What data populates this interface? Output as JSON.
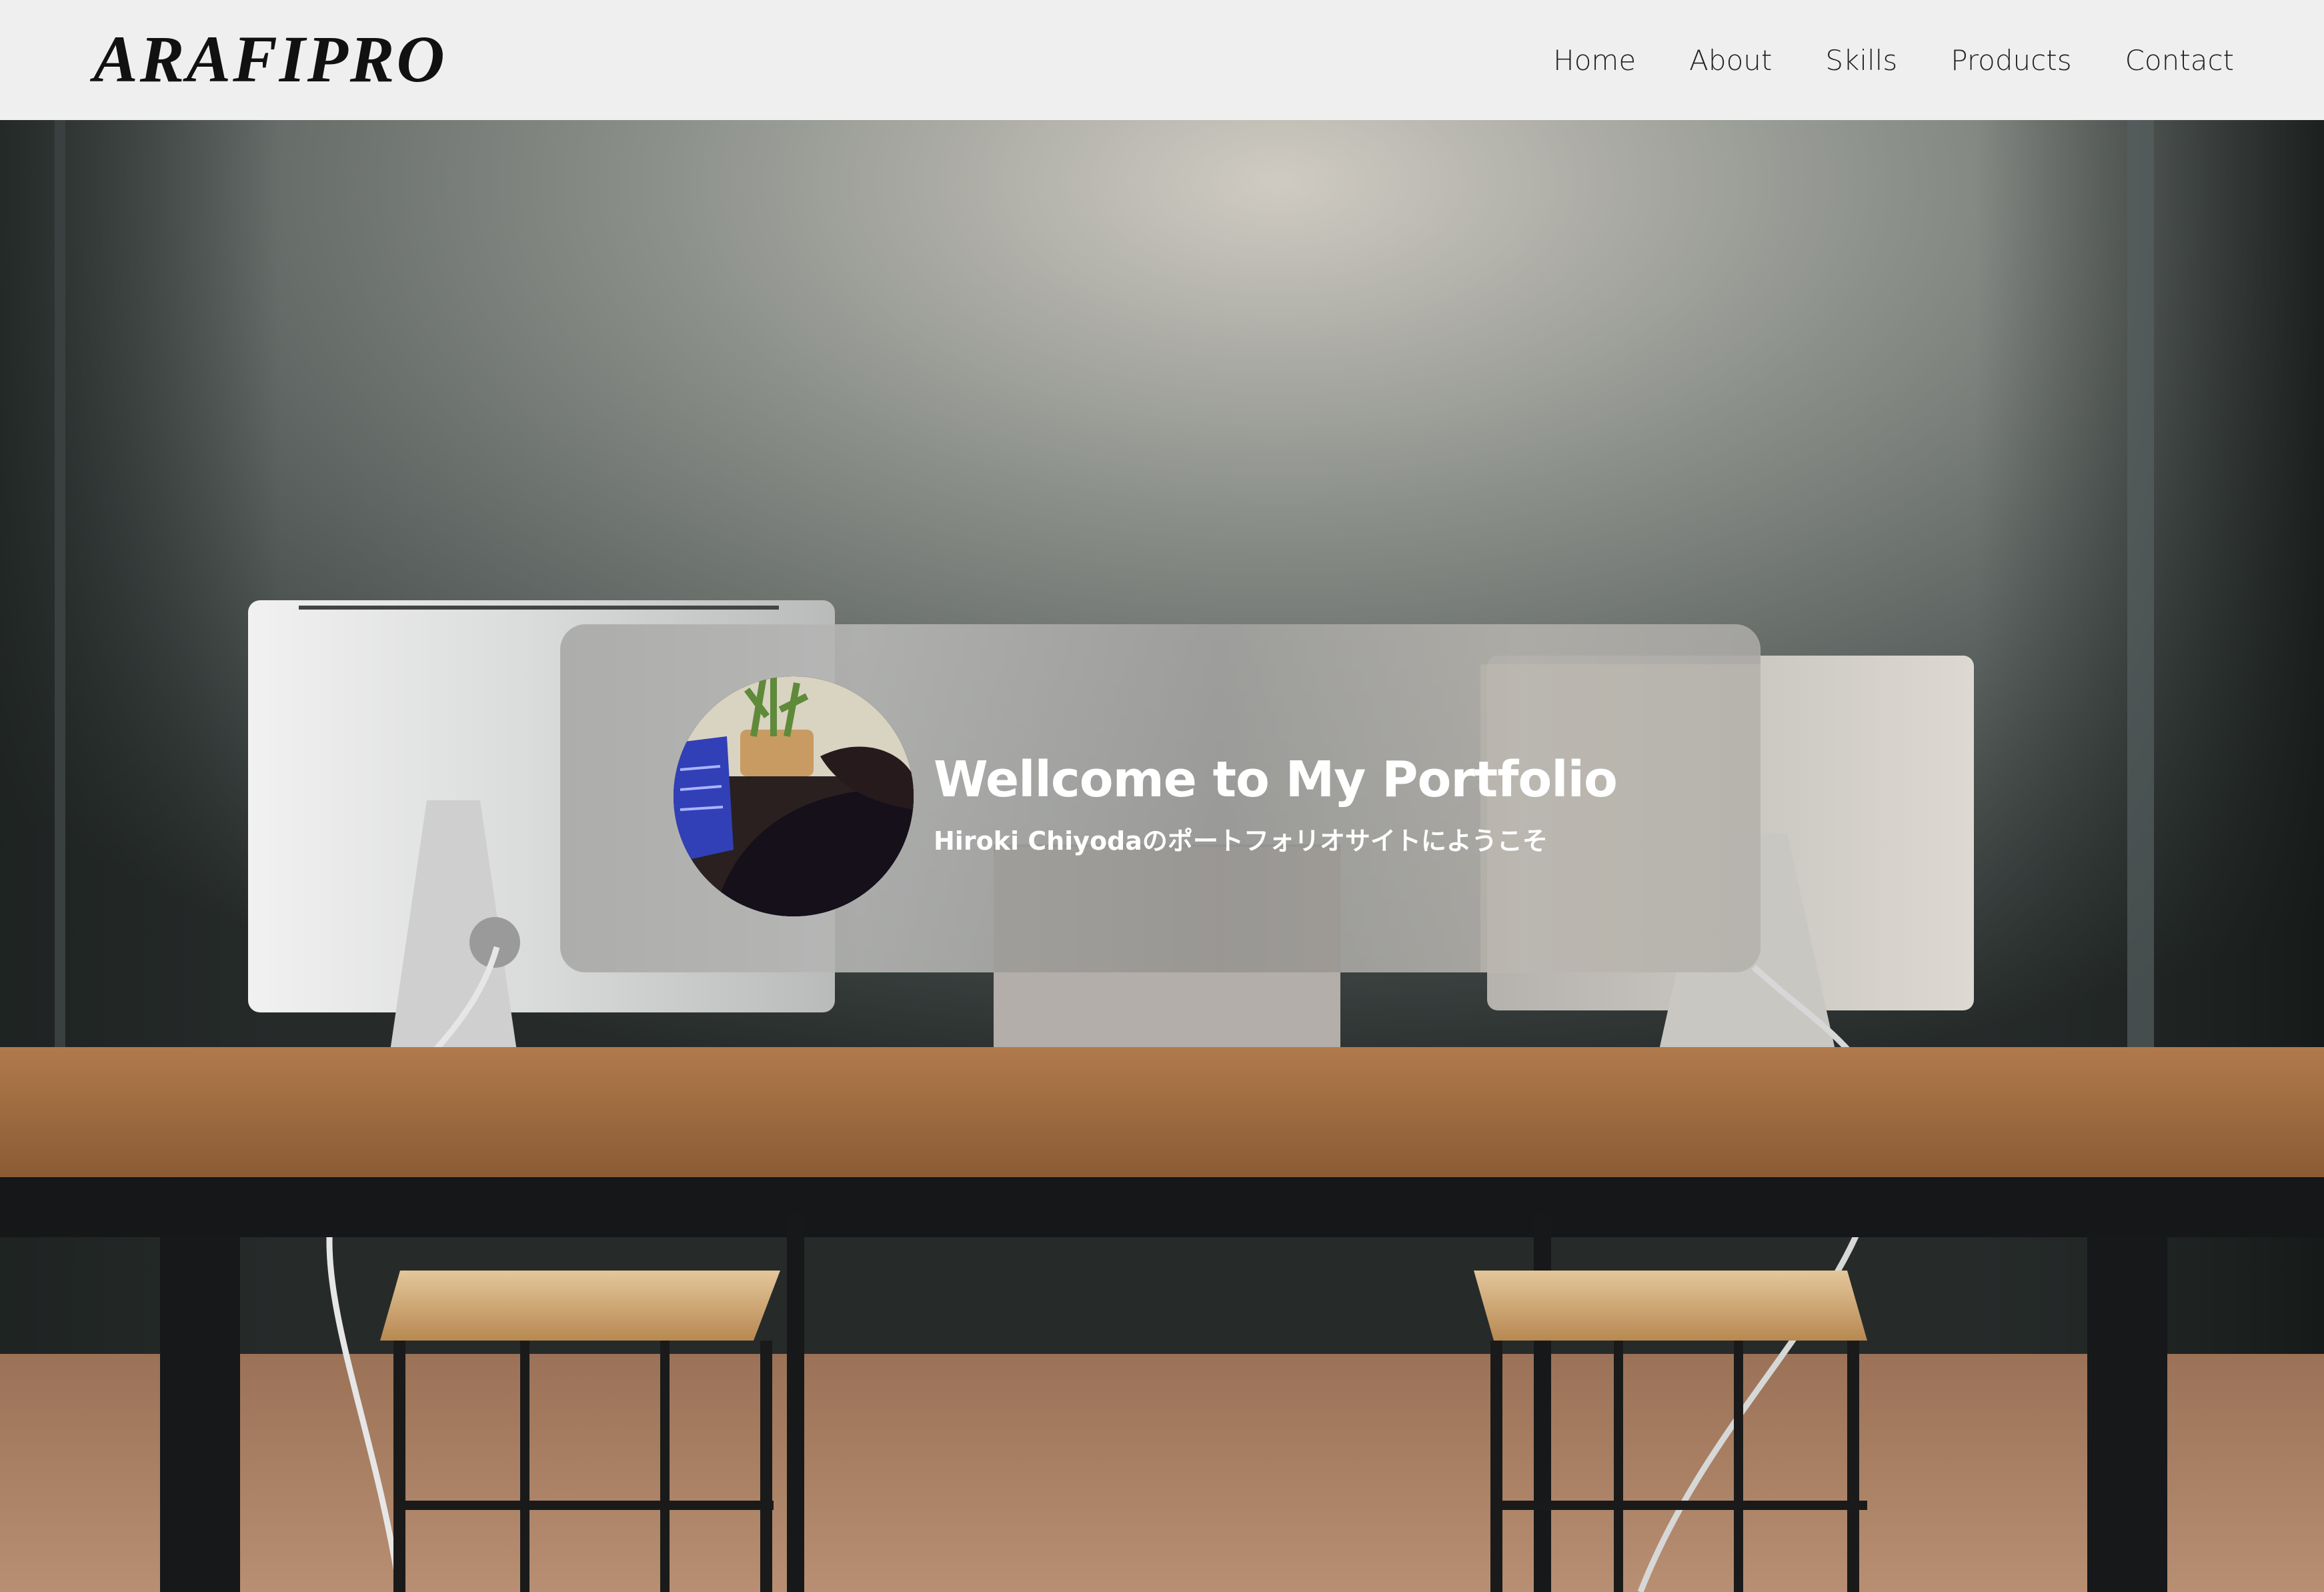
{
  "header": {
    "logo": "ARAFIPRO",
    "nav": [
      {
        "label": "Home"
      },
      {
        "label": "About"
      },
      {
        "label": "Skills"
      },
      {
        "label": "Products"
      },
      {
        "label": "Contact"
      }
    ]
  },
  "hero": {
    "title": "Wellcome to My Portfolio",
    "subtitle": "Hiroki Chiyodaのポートフォリオサイトにようこそ"
  },
  "colors": {
    "header_bg": "#efefef",
    "card_bg": "#aaaaa8",
    "text_light": "#ffffff",
    "text_dark": "#111111"
  }
}
